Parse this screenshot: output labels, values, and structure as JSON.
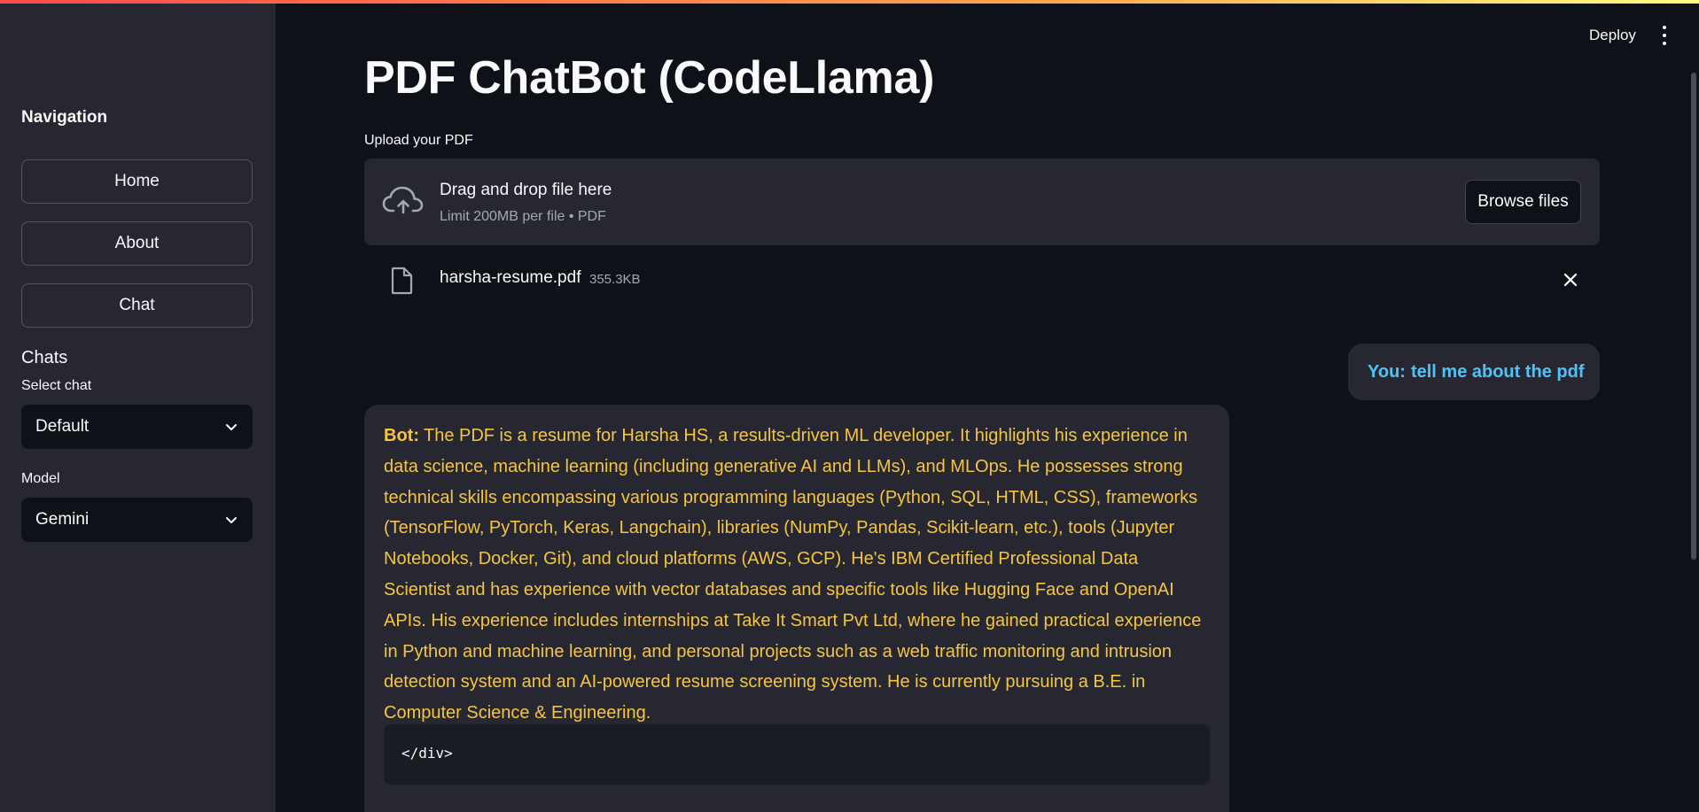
{
  "app": {
    "deploy_label": "Deploy",
    "menu_icon": "more-vertical-icon"
  },
  "sidebar": {
    "nav_title": "Navigation",
    "nav_items": [
      {
        "label": "Home"
      },
      {
        "label": "About"
      },
      {
        "label": "Chat"
      }
    ],
    "chats_heading": "Chats",
    "select_chat": {
      "label": "Select chat",
      "value": "Default"
    },
    "model": {
      "label": "Model",
      "value": "Gemini"
    }
  },
  "main": {
    "title": "PDF ChatBot (CodeLlama)",
    "uploader": {
      "label": "Upload your PDF",
      "drop_title": "Drag and drop file here",
      "drop_subtitle": "Limit 200MB per file • PDF",
      "browse_label": "Browse files"
    },
    "file": {
      "name": "harsha-resume.pdf",
      "size": "355.3KB"
    },
    "messages": [
      {
        "role": "user",
        "prefix": "You:",
        "text": "tell me about the pdf",
        "color": "#4fc3f7"
      },
      {
        "role": "bot",
        "prefix": "Bot:",
        "text": "The PDF is a resume for Harsha HS, a results-driven ML developer. It highlights his experience in data science, machine learning (including generative AI and LLMs), and MLOps. He possesses strong technical skills encompassing various programming languages (Python, SQL, HTML, CSS), frameworks (TensorFlow, PyTorch, Keras, Langchain), libraries (NumPy, Pandas, Scikit-learn, etc.), tools (Jupyter Notebooks, Docker, Git), and cloud platforms (AWS, GCP). He's IBM Certified Professional Data Scientist and has experience with vector databases and specific tools like Hugging Face and OpenAI APIs. His experience includes internships at Take It Smart Pvt Ltd, where he gained practical experience in Python and machine learning, and personal projects such as a web traffic monitoring and intrusion detection system and an AI-powered resume screening system. He is currently pursuing a B.E. in Computer Science & Engineering.",
        "code": "</div>",
        "color": "#f5c542"
      }
    ]
  }
}
